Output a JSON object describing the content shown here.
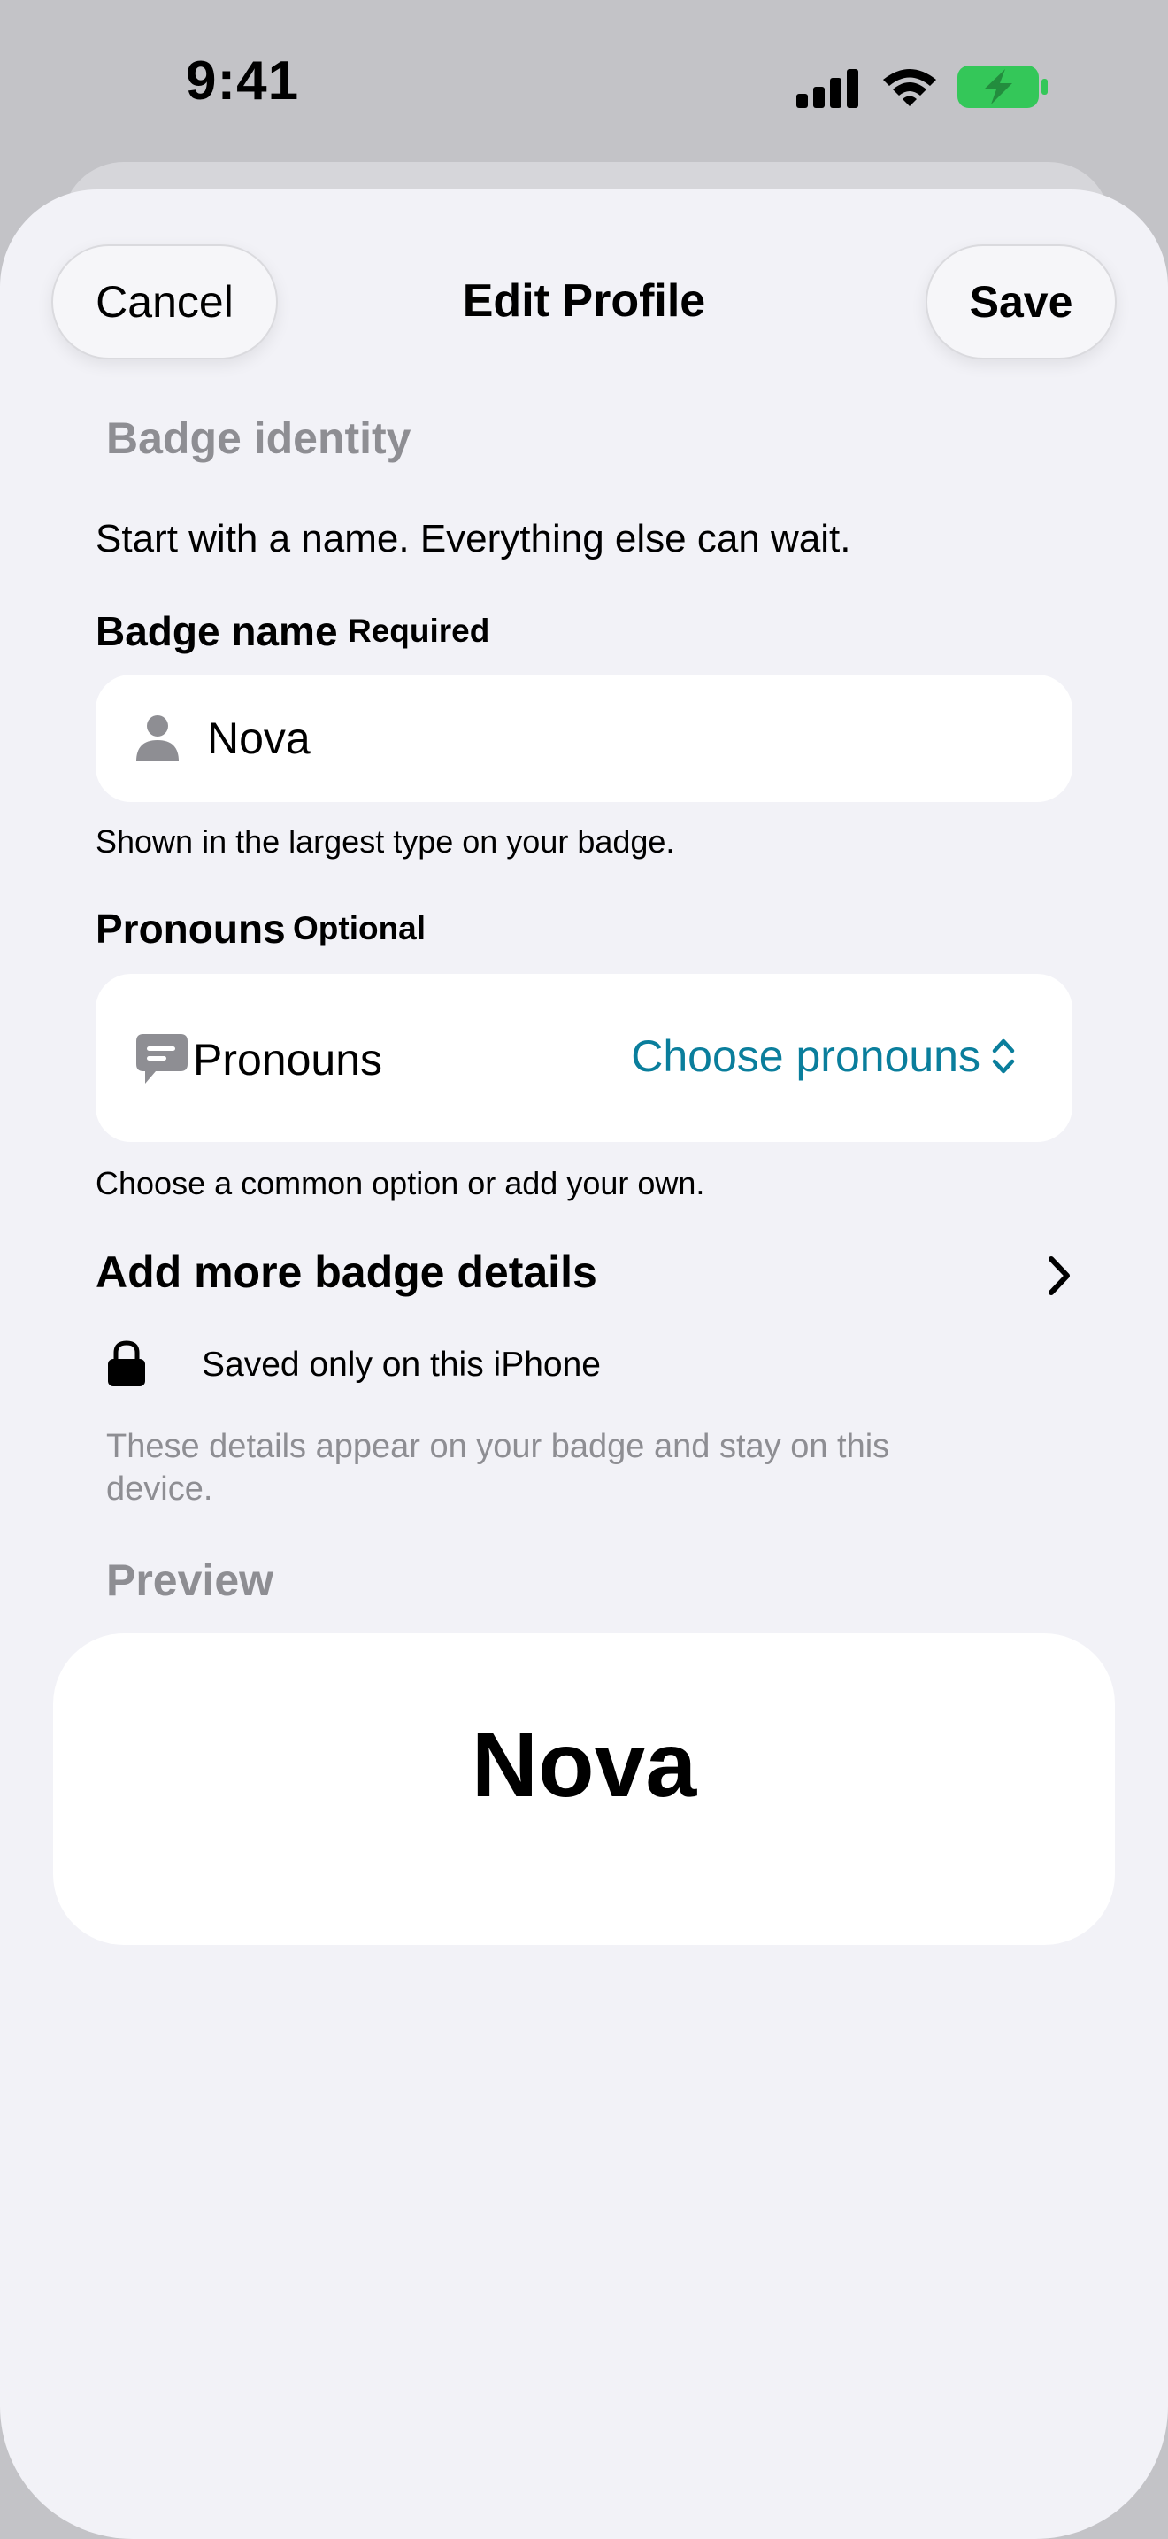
{
  "status_bar": {
    "time": "9:41",
    "icons": [
      "cellular-signal-icon",
      "wifi-icon",
      "battery-charging-icon"
    ],
    "battery_color": "#34c759"
  },
  "nav": {
    "cancel_label": "Cancel",
    "title": "Edit Profile",
    "save_label": "Save"
  },
  "identity": {
    "section_title": "Badge identity",
    "intro": "Start with a name. Everything else can wait."
  },
  "name_field": {
    "label": "Badge name",
    "tag": "Required",
    "value": "Nova",
    "icon": "person-icon",
    "hint": "Shown in the largest type on your badge."
  },
  "pronouns_field": {
    "label": "Pronouns",
    "tag": "Optional",
    "row_label": "Pronouns",
    "icon": "chat-bubble-icon",
    "value": "Choose pronouns",
    "hint": "Choose a common option or add your own.",
    "accent_color": "#0a7e9c"
  },
  "more_details": {
    "label": "Add more badge details"
  },
  "privacy": {
    "label": "Saved only on this iPhone",
    "icon": "lock-icon",
    "note": "These details appear on your badge and stay on this device."
  },
  "preview": {
    "section_title": "Preview",
    "name": "Nova"
  }
}
